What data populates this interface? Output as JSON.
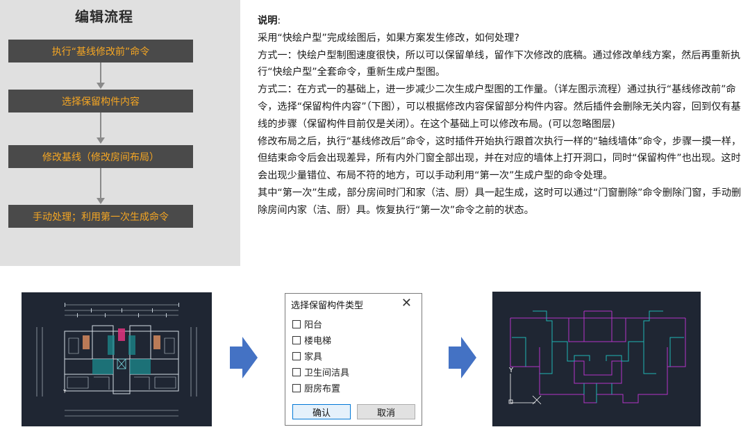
{
  "flow": {
    "title": "编辑流程",
    "steps": [
      "执行“基线修改前”命令",
      "选择保留构件内容",
      "修改基线（修改房间布局）",
      "手动处理；利用第一次生成命令"
    ]
  },
  "description": {
    "heading": "说明",
    "heading_colon": ":",
    "paragraphs": [
      "采用“快绘户型”完成绘图后，如果方案发生修改，如何处理?",
      "方式一：快绘户型制图速度很快，所以可以保留单线，留作下次修改的底稿。通过修改单线方案，然后再重新执行“快绘户型”全套命令，重新生成户型图。",
      "方式二：在方式一的基础上，进一步减少二次生成户型图的工作量。（详左图示流程）通过执行“基线修改前”命令，选择“保留构件内容”（下图），可以根据修改内容保留部分构件内容。然后插件会删除无关内容，回到仅有基线的步骤（保留构件目前仅是关闭）。在这个基础上可以修改布局。(可以忽略图层)",
      "修改布局之后，执行“基线修改后”命令，这时插件开始执行跟首次执行一样的“轴线墙体”命令，步骤一摸一样，但结束命令后会出现差异，所有内外门窗全部出现，并在对应的墙体上打开洞口，同时“保留构件”也出现。这时会出现少量错位、布局不符的地方，可以手动利用“第一次”生成户型的命令处理。",
      "其中“第一次”生成，部分房间时门和家（洁、厨）具一起生成，这时可以通过“门窗删除”命令删除门窗，手动删除房间内家（洁、厨）具。恢复执行“第一次”命令之前的状态。"
    ]
  },
  "dialog": {
    "title": "选择保留构件类型",
    "close_glyph": "✕",
    "options": [
      {
        "label": "阳台",
        "checked": false
      },
      {
        "label": "楼电梯",
        "checked": false
      },
      {
        "label": "家具",
        "checked": false
      },
      {
        "label": "卫生间洁具",
        "checked": false
      },
      {
        "label": "厨房布置",
        "checked": false
      }
    ],
    "ok_label": "确认",
    "cancel_label": "取消"
  },
  "cad": {
    "axis_y_label": "Y"
  },
  "colors": {
    "flow_box_bg": "#4a4a4a",
    "flow_text": "#f5a623",
    "cad_bg": "#1f2633",
    "arrow_blue": "#4472c4",
    "cad_magenta": "#b634c8",
    "cad_cyan": "#1fb5b5"
  }
}
